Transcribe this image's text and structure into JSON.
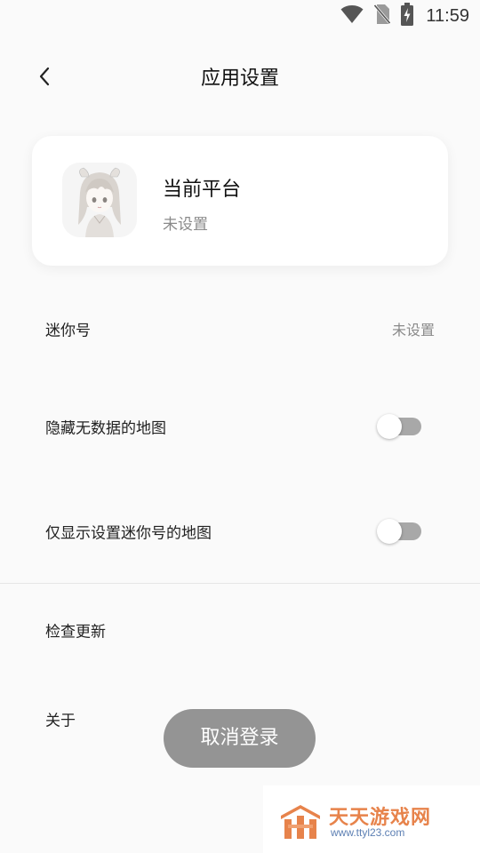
{
  "status_bar": {
    "time": "11:59",
    "icons": [
      "wifi-icon",
      "no-sim-icon",
      "battery-charging-icon"
    ]
  },
  "header": {
    "title": "应用设置",
    "back_icon": "chevron-left-icon"
  },
  "platform_card": {
    "title": "当前平台",
    "subtitle": "未设置",
    "avatar": "anime-girl-avatar"
  },
  "settings": {
    "mini_number": {
      "label": "迷你号",
      "value": "未设置"
    },
    "hide_no_data_maps": {
      "label": "隐藏无数据的地图",
      "enabled": false
    },
    "show_only_mini_maps": {
      "label": "仅显示设置迷你号的地图",
      "enabled": false
    },
    "check_update": {
      "label": "检查更新"
    },
    "about": {
      "label": "关于"
    }
  },
  "logout_button": {
    "label": "取消登录"
  },
  "watermark": {
    "name": "天天游戏网",
    "url": "www.ttyl23.com"
  },
  "colors": {
    "background": "#fafafa",
    "card": "#ffffff",
    "toggle_track_off": "#a8a8a8",
    "logout_button": "#8f8f8f",
    "watermark_orange": "#e7834b",
    "watermark_blue": "#5c7fb3"
  }
}
